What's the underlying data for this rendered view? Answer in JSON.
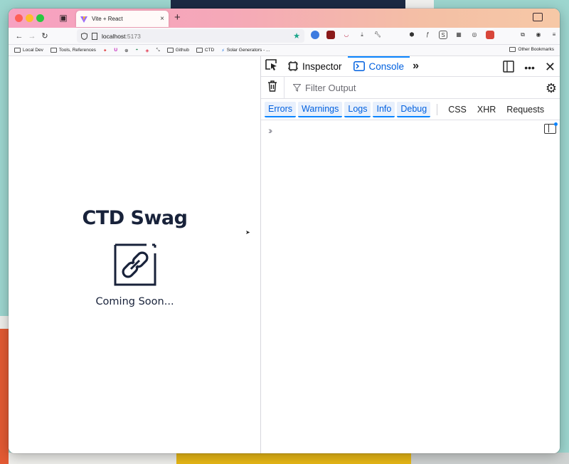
{
  "browser": {
    "tab_title": "Vite + React",
    "tab_close": "×",
    "new_tab": "+",
    "url_host": "localhost",
    "url_port": ":5173"
  },
  "bookmarks": [
    {
      "label": "Local Dev",
      "icon": "folder"
    },
    {
      "label": "Tools, References",
      "icon": "folder"
    },
    {
      "label": "",
      "icon": "codepen"
    },
    {
      "label": "",
      "icon": "u-logo"
    },
    {
      "label": "",
      "icon": "globe"
    },
    {
      "label": "",
      "icon": "planet"
    },
    {
      "label": "",
      "icon": "pocket"
    },
    {
      "label": "",
      "icon": "pin"
    },
    {
      "label": "Github",
      "icon": "folder"
    },
    {
      "label": "CTD",
      "icon": "folder"
    },
    {
      "label": "Solar Generators - ...",
      "icon": "bolt"
    }
  ],
  "other_bookmarks": "Other Bookmarks",
  "page": {
    "title": "CTD Swag",
    "subtitle": "Coming Soon..."
  },
  "devtools": {
    "inspector_label": "Inspector",
    "console_label": "Console",
    "filter_placeholder": "Filter Output",
    "levels": [
      "Errors",
      "Warnings",
      "Logs",
      "Info",
      "Debug"
    ],
    "extra_filters": [
      "CSS",
      "XHR",
      "Requests"
    ]
  },
  "colors": {
    "accent": "#0a84ff",
    "page_text": "#18223a"
  }
}
